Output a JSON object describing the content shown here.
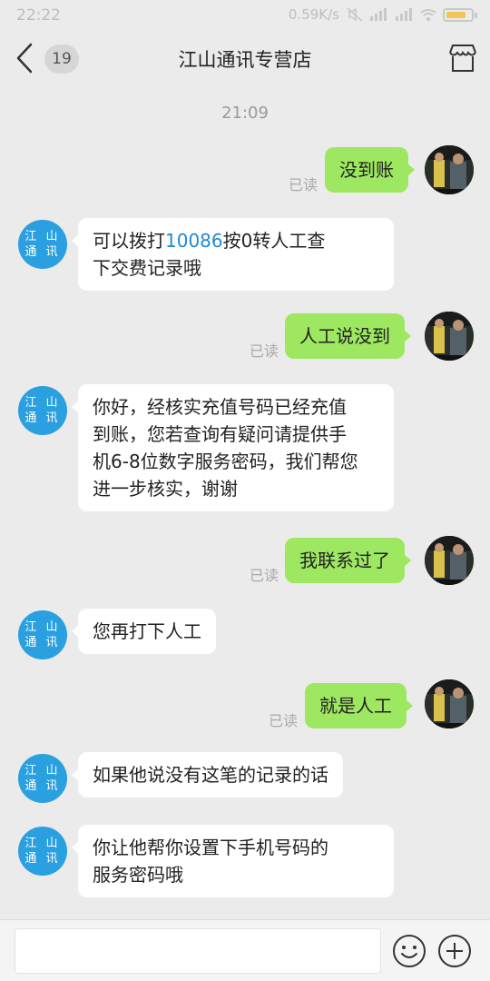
{
  "status_bar": {
    "time": "22:22",
    "speed": "0.59K/s"
  },
  "header": {
    "unread_count": "19",
    "title": "江山通讯专营店"
  },
  "chat": {
    "timestamp": "21:09",
    "read_label": "已读",
    "shop_avatar": {
      "line1": "江 山",
      "line2": "通 讯"
    },
    "messages": [
      {
        "side": "out",
        "text": "没到账"
      },
      {
        "side": "in",
        "parts": [
          "可以拨打",
          "10086",
          "按0转人工查"
        ],
        "line2": "下交费记录哦"
      },
      {
        "side": "out",
        "text": "人工说没到"
      },
      {
        "side": "in",
        "lines": [
          "你好，经核实充值号码已经充值",
          "到账，您若查询有疑问请提供手",
          "机6-8位数字服务密码，我们帮您",
          "进一步核实，谢谢"
        ]
      },
      {
        "side": "out",
        "text": "我联系过了"
      },
      {
        "side": "in",
        "text": "您再打下人工"
      },
      {
        "side": "out",
        "text": "就是人工"
      },
      {
        "side": "in",
        "text": "如果他说没有这笔的记录的话"
      },
      {
        "side": "in",
        "lines": [
          "你让他帮你设置下手机号码的",
          "服务密码哦"
        ]
      }
    ]
  },
  "input_bar": {
    "placeholder": "",
    "emoji_icon": "smiley-icon",
    "plus_icon": "plus-circle-icon"
  },
  "colors": {
    "background": "#ebebeb",
    "outgoing_bubble": "#9ee761",
    "incoming_bubble": "#ffffff",
    "shop_avatar": "#2aa0e0",
    "link": "#1f8ad1"
  }
}
